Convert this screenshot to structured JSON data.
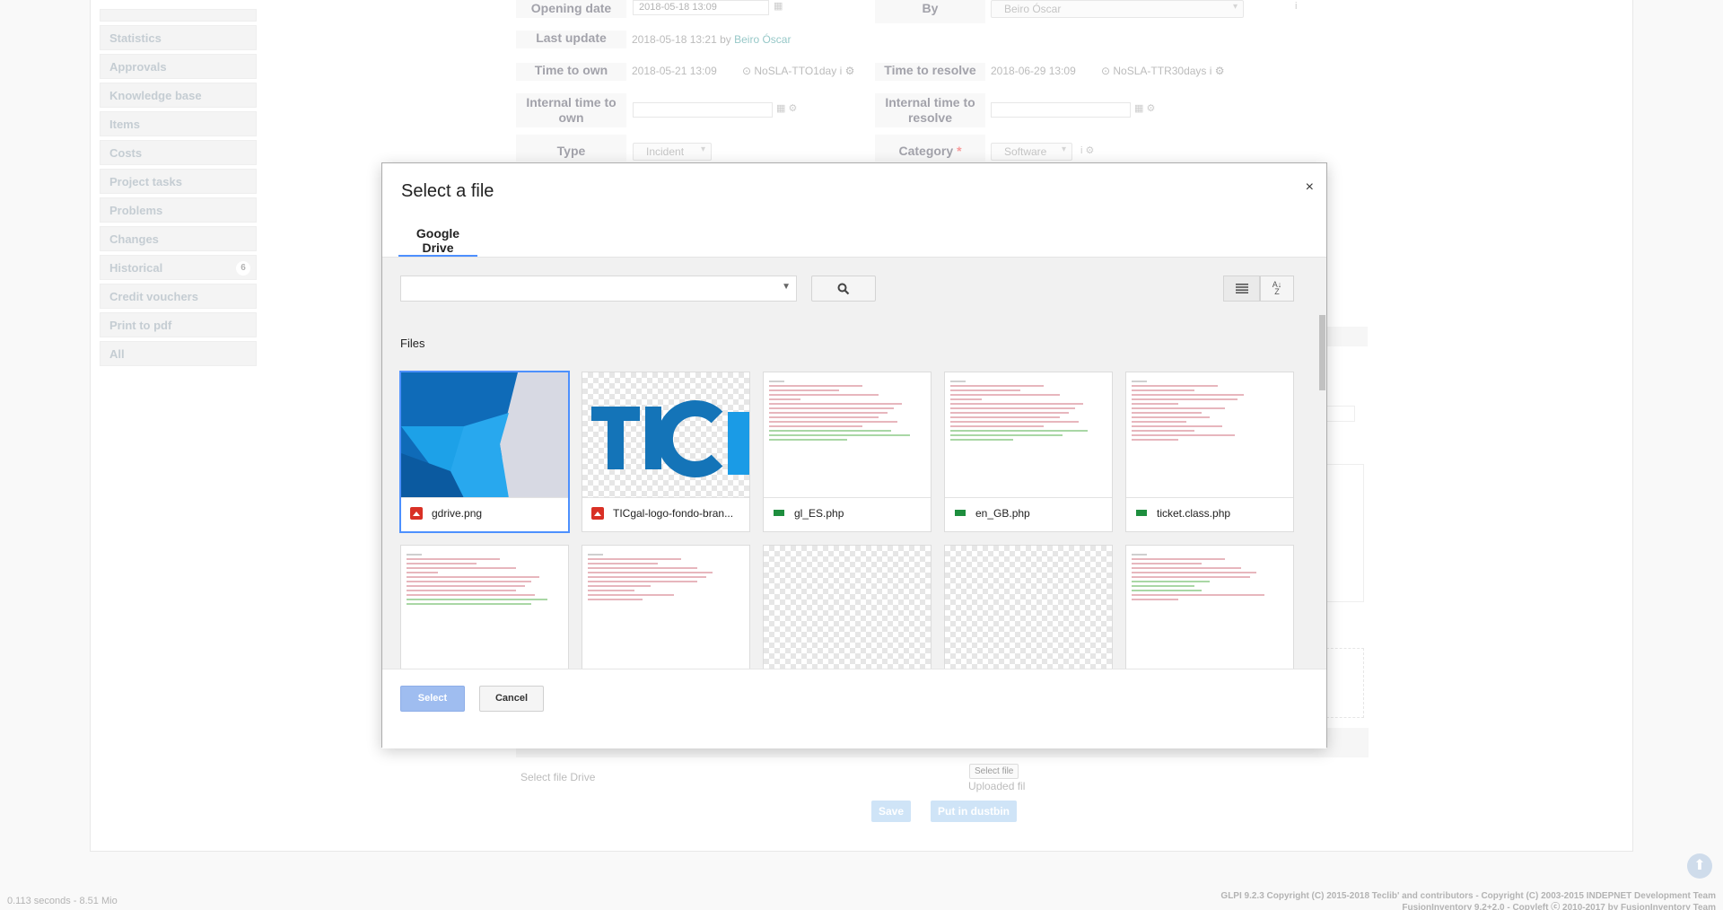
{
  "sidebar": {
    "items": [
      {
        "label": "Statistics"
      },
      {
        "label": "Approvals"
      },
      {
        "label": "Knowledge base"
      },
      {
        "label": "Items"
      },
      {
        "label": "Costs"
      },
      {
        "label": "Project tasks"
      },
      {
        "label": "Problems"
      },
      {
        "label": "Changes"
      },
      {
        "label": "Historical",
        "count": "6"
      },
      {
        "label": "Credit vouchers"
      },
      {
        "label": "Print to pdf"
      },
      {
        "label": "All"
      }
    ]
  },
  "ticket": {
    "opening_date_label": "Opening date",
    "opening_date_value": "2018-05-18 13:09",
    "by_label": "By",
    "by_value": "Beiro Óscar",
    "last_update_label": "Last update",
    "last_update_value": "2018-05-18 13:21 by",
    "last_update_user": "Beiro Óscar",
    "time_to_own_label": "Time to own",
    "time_to_own_value": "2018-05-21 13:09",
    "time_to_own_sla": "NoSLA-TTO1day",
    "time_to_resolve_label": "Time to resolve",
    "time_to_resolve_value": "2018-06-29 13:09",
    "time_to_resolve_sla": "NoSLA-TTR30days",
    "internal_time_to_own_label": "Internal time to own",
    "internal_time_to_resolve_label": "Internal time to resolve",
    "type_label": "Type",
    "type_value": "Incident",
    "category_label": "Category",
    "category_required": "*",
    "category_value": "Software",
    "select_file_drive_label": "Select file Drive",
    "select_file_button": "Select file",
    "uploaded_file_label": "Uploaded fil",
    "save_button": "Save",
    "dustbin_button": "Put in dustbin"
  },
  "footer": {
    "timing": "0.113 seconds - 8.51 Mio",
    "copyright_line1": "GLPI 9.2.3 Copyright (C) 2015-2018 Teclib' and contributors - Copyright (C) 2003-2015 INDEPNET Development Team",
    "copyright_line2": "FusionInventory 9.2+2.0 - Copyleft ⓒ 2010-2017 by FusionInventory Team"
  },
  "picker": {
    "title": "Select a file",
    "close_icon": "×",
    "tab_label": "Google Drive",
    "search_placeholder": "",
    "files_label": "Files",
    "select_button": "Select",
    "cancel_button": "Cancel",
    "files": [
      {
        "name": "gdrive.png",
        "kind": "image",
        "selected": true
      },
      {
        "name": "TICgal-logo-fondo-bran...",
        "kind": "image"
      },
      {
        "name": "gl_ES.php",
        "kind": "php"
      },
      {
        "name": "en_GB.php",
        "kind": "php"
      },
      {
        "name": "ticket.class.php",
        "kind": "php"
      },
      {
        "name": "",
        "kind": "php"
      },
      {
        "name": "",
        "kind": "php"
      },
      {
        "name": "",
        "kind": "other"
      },
      {
        "name": "",
        "kind": "other"
      },
      {
        "name": "",
        "kind": "php"
      }
    ]
  },
  "colors": {
    "accent": "#4d90fe",
    "select_button_disabled": "#9fbdf0",
    "link": "#2b8f8f"
  }
}
